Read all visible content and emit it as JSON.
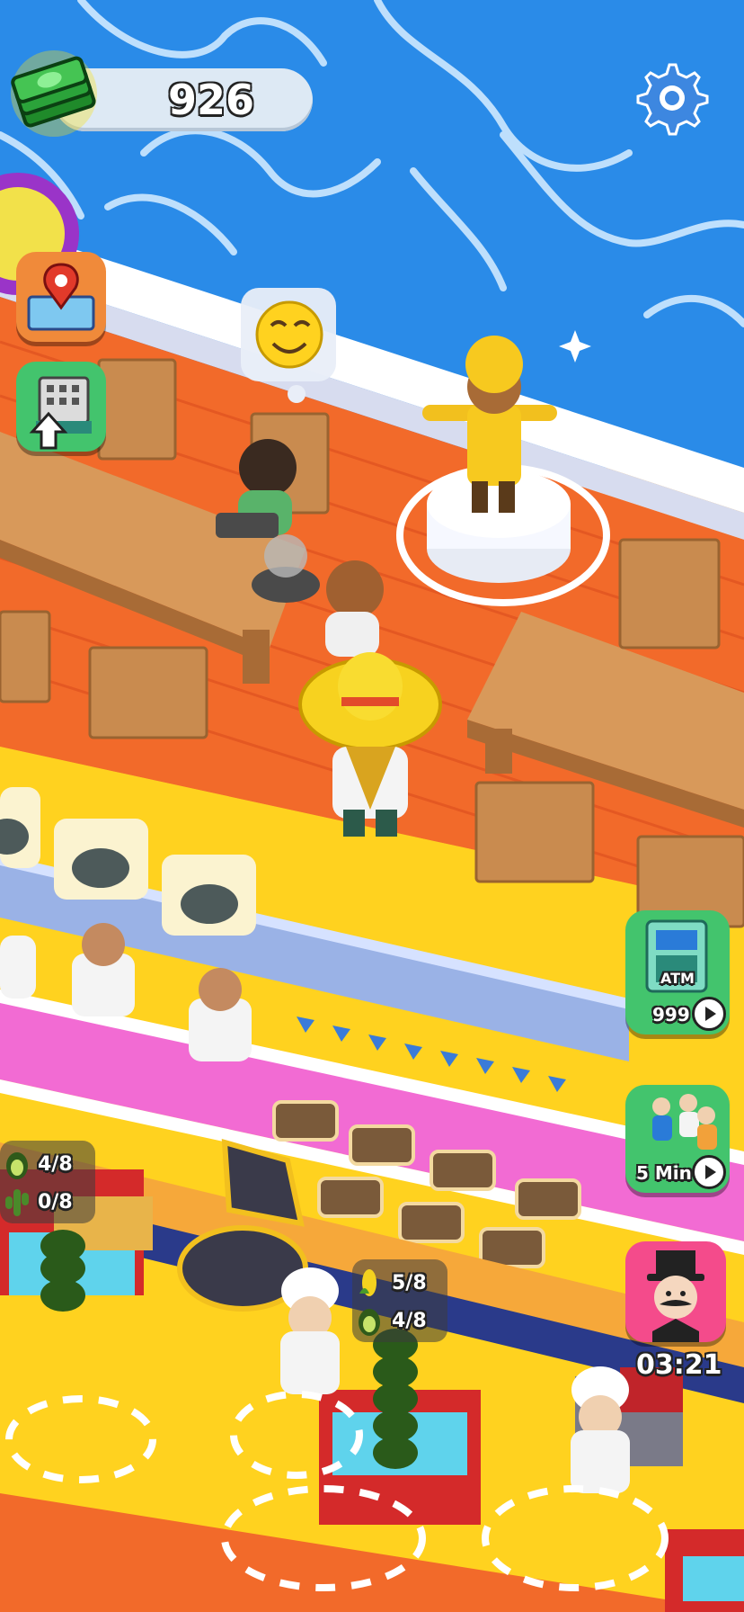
{
  "hud": {
    "money": "926",
    "icons": {
      "money": "cash-stack-icon",
      "settings": "gear-icon",
      "map": "map-pin-icon",
      "upgrade": "board-upgrade-icon"
    }
  },
  "side_panel": {
    "atm_label": "ATM",
    "atm_value": "999",
    "boost_label": "5 Min",
    "customer_timer": "03:21"
  },
  "stations": {
    "left_top": "4/8",
    "left_bottom": "0/8",
    "center_top": "5/8",
    "center_bottom": "4/8"
  },
  "colors": {
    "water": "#2a8be8",
    "floor": "#f26a2a",
    "wall_top": "#ffffff",
    "lane_yellow": "#ffd21f",
    "lane_pink": "#f26bd3",
    "wood": "#d8995a",
    "button_green": "#43c46d",
    "button_orange": "#f08a3a",
    "button_pink": "#f44b8b"
  }
}
